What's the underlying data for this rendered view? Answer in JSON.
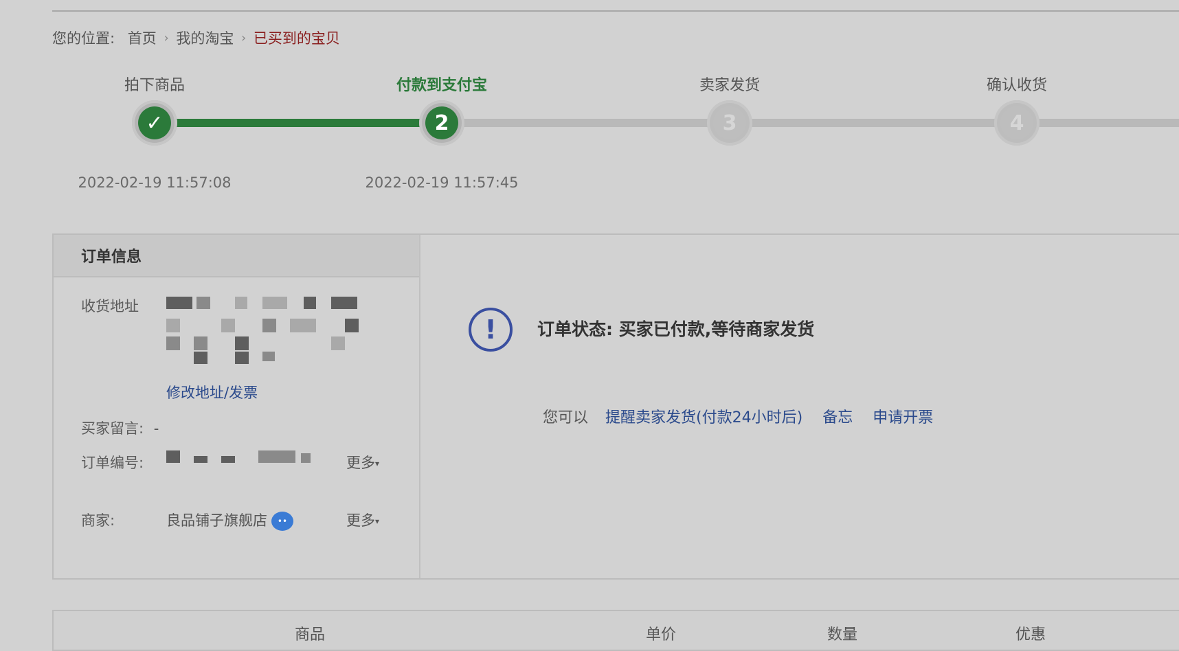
{
  "breadcrumb": {
    "prefix": "您的位置:",
    "items": [
      "首页",
      "我的淘宝",
      "已买到的宝贝"
    ],
    "separator": "›"
  },
  "steps": [
    {
      "label": "拍下商品",
      "marker": "✓",
      "state": "done",
      "time": "2022-02-19 11:57:08"
    },
    {
      "label": "付款到支付宝",
      "marker": "2",
      "state": "current",
      "time": "2022-02-19 11:57:45"
    },
    {
      "label": "卖家发货",
      "marker": "3",
      "state": "pending",
      "time": ""
    },
    {
      "label": "确认收货",
      "marker": "4",
      "state": "pending",
      "time": ""
    }
  ],
  "order_info": {
    "title": "订单信息",
    "address_label": "收货地址",
    "edit_address_link": "修改地址/发票",
    "buyer_note_label": "买家留言:",
    "buyer_note_value": "-",
    "order_no_label": "订单编号:",
    "merchant_label": "商家:",
    "merchant_name": "良品铺子旗舰店",
    "more_label": "更多"
  },
  "status": {
    "text": "订单状态: 买家已付款,等待商家发货",
    "icon": "exclamation-circle-icon",
    "actions_prefix": "您可以",
    "actions": [
      "提醒卖家发货(付款24小时后)",
      "备忘",
      "申请开票"
    ]
  },
  "goods_table": {
    "columns": [
      "商品",
      "单价",
      "数量",
      "优惠"
    ]
  },
  "colors": {
    "accent_green": "#2b7a3a",
    "link_blue": "#2b4a8c",
    "breadcrumb_current": "#8a1f1f"
  }
}
